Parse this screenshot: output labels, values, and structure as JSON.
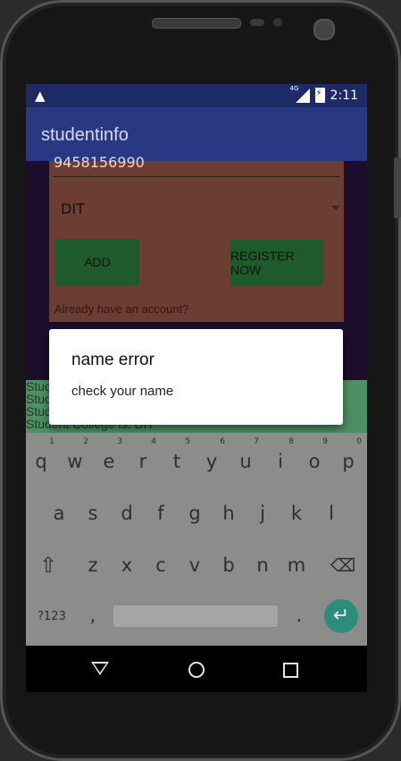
{
  "status_bar": {
    "network": "4G",
    "time": "2:11",
    "warning_glyph": "▲"
  },
  "app_bar": {
    "title": "studentinfo"
  },
  "form": {
    "phone_value": "9458156990",
    "college_selected": "DIT",
    "add_label": "ADD",
    "register_label": "REGISTER NOW",
    "already_text": "Already have an account?"
  },
  "list": {
    "lines": [
      "Stud",
      "Stud",
      "Stud",
      "Student College is: DIT"
    ]
  },
  "dialog": {
    "title": "name error",
    "message": "check your name"
  },
  "keyboard": {
    "row1": [
      [
        "q",
        "1"
      ],
      [
        "w",
        "2"
      ],
      [
        "e",
        "3"
      ],
      [
        "r",
        "4"
      ],
      [
        "t",
        "5"
      ],
      [
        "y",
        "6"
      ],
      [
        "u",
        "7"
      ],
      [
        "i",
        "8"
      ],
      [
        "o",
        "9"
      ],
      [
        "p",
        "0"
      ]
    ],
    "row2": [
      "a",
      "s",
      "d",
      "f",
      "g",
      "h",
      "j",
      "k",
      "l"
    ],
    "row3": [
      "z",
      "x",
      "c",
      "v",
      "b",
      "n",
      "m"
    ],
    "symbols_label": "?123",
    "comma": ",",
    "period": ".",
    "shift_icon": "shift-icon",
    "backspace_icon": "backspace-icon",
    "enter_icon": "enter-icon"
  },
  "colors": {
    "status_bar": "#1e2a66",
    "app_bar": "#283882",
    "card": "#6b3d33",
    "button": "#1f5a2c",
    "list": "#4f8f64",
    "enter_key": "#2e8c7c"
  }
}
